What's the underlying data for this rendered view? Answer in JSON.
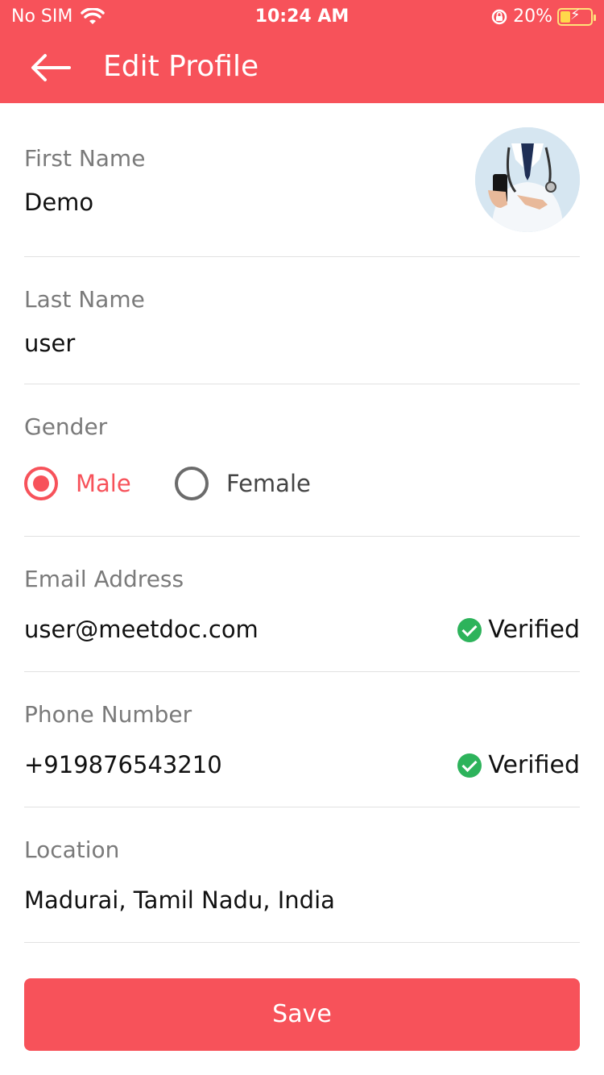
{
  "status_bar": {
    "carrier": "No SIM",
    "time": "10:24 AM",
    "battery": "20%",
    "icons": [
      "wifi-icon",
      "orientation-lock-icon",
      "battery-icon"
    ]
  },
  "header": {
    "title": "Edit Profile",
    "back_icon": "arrow-left-icon",
    "background": "#F7525A"
  },
  "profile": {
    "first_name_label": "First Name",
    "first_name": "Demo",
    "last_name_label": "Last Name",
    "last_name": "user",
    "gender_label": "Gender",
    "gender_options": [
      "Male",
      "Female"
    ],
    "gender_selected": "Male",
    "email_label": "Email Address",
    "email": "user@meetdoc.com",
    "email_status": "Verified",
    "phone_label": "Phone Number",
    "phone": "+919876543210",
    "phone_status": "Verified",
    "location_label": "Location",
    "location": "Madurai, Tamil Nadu, India"
  },
  "actions": {
    "save_label": "Save"
  },
  "colors": {
    "accent": "#F7525A",
    "verified": "#2DB35B"
  }
}
